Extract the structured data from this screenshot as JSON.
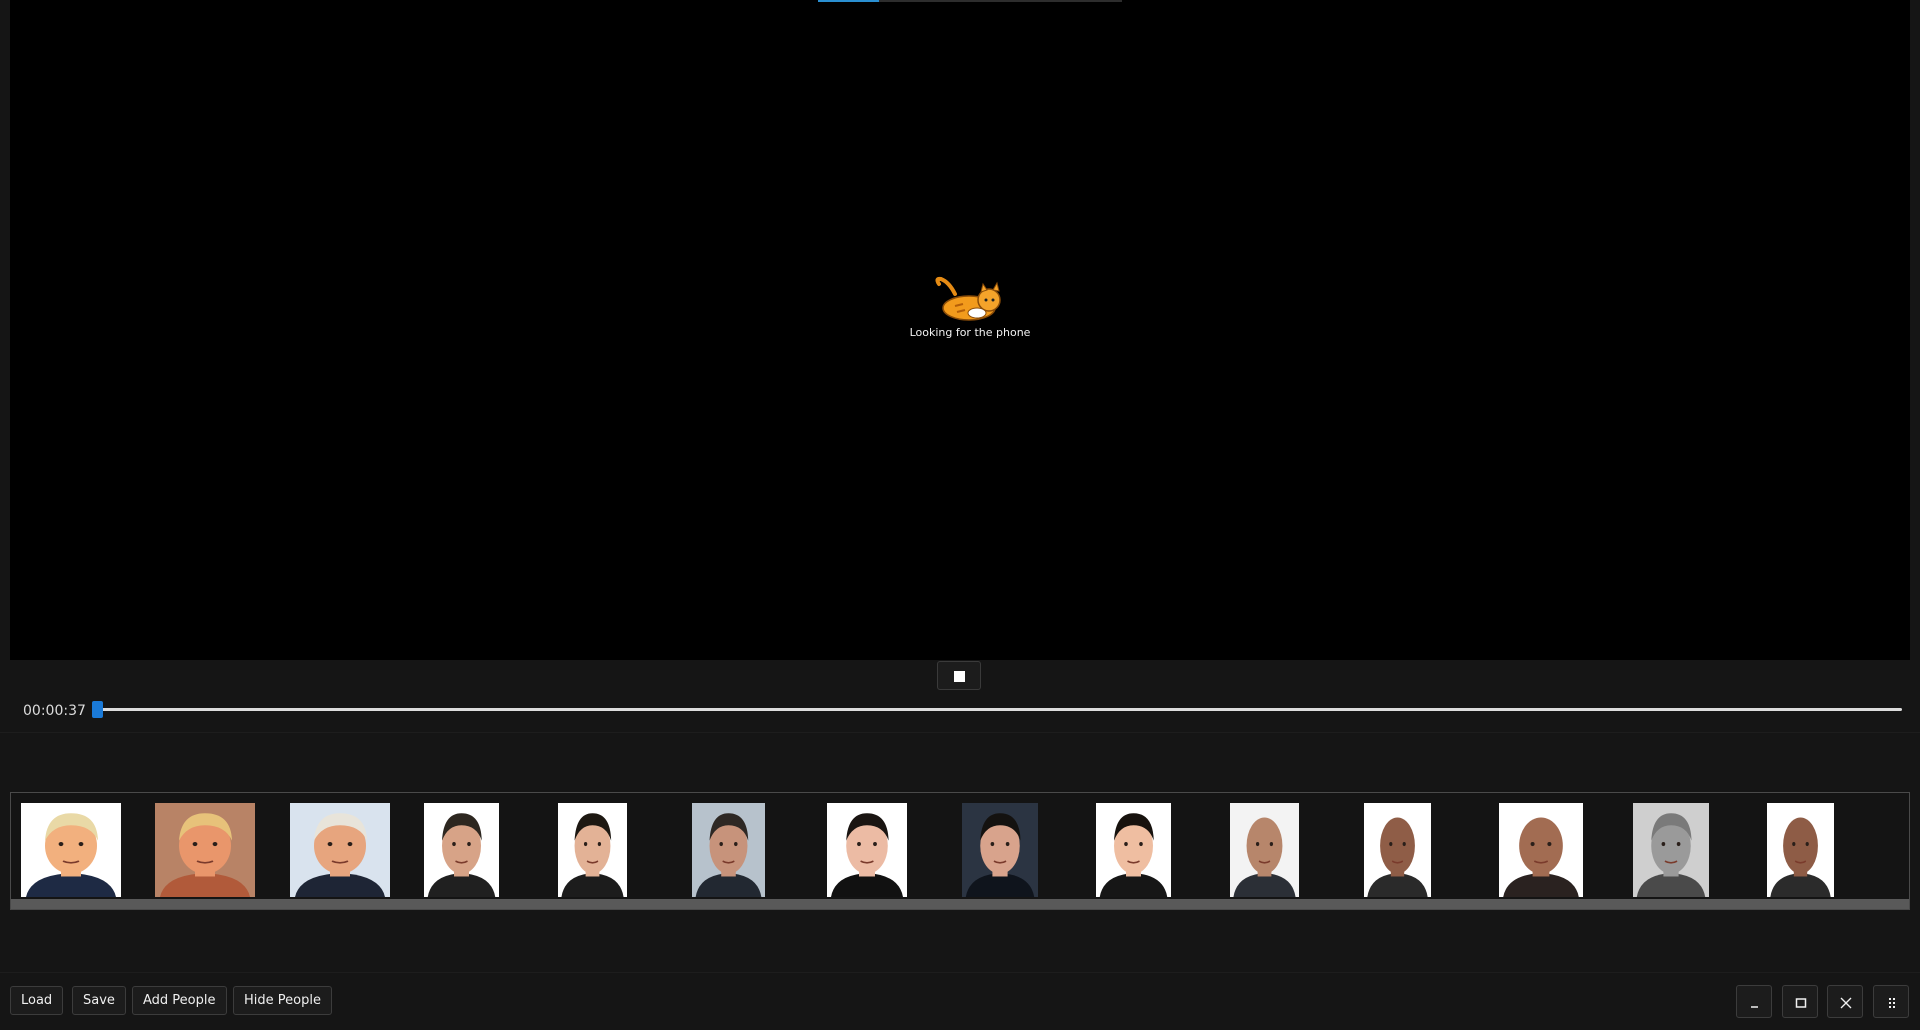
{
  "player": {
    "loading_text": "Looking for the phone",
    "top_progress": 0.2,
    "time": "00:00:37",
    "seek_position": 0.003
  },
  "people": [
    {
      "name": "",
      "bg": "#ffffff",
      "skin": "#f2b07e",
      "hair": "#e9d9a6",
      "suit": "#1e2a44"
    },
    {
      "name": "",
      "bg": "#b88366",
      "skin": "#e9966b",
      "hair": "#e7c27a",
      "suit": "#b15a3a"
    },
    {
      "name": "",
      "bg": "#d9e3ee",
      "skin": "#e7a57e",
      "hair": "#e8e4da",
      "suit": "#1e2535"
    },
    {
      "name": "",
      "bg": "#ffffff",
      "skin": "#d7a387",
      "hair": "#2d2720",
      "suit": "#202020"
    },
    {
      "name": "",
      "bg": "#ffffff",
      "skin": "#e3b296",
      "hair": "#1d1812",
      "suit": "#1c1c1c"
    },
    {
      "name": "",
      "bg": "#b7c2cc",
      "skin": "#c7937b",
      "hair": "#2e2824",
      "suit": "#222831"
    },
    {
      "name": "",
      "bg": "#ffffff",
      "skin": "#ecbba4",
      "hair": "#1a1512",
      "suit": "#111111"
    },
    {
      "name": "",
      "bg": "#2b3442",
      "skin": "#d8a38c",
      "hair": "#141210",
      "suit": "#0f141c"
    },
    {
      "name": "",
      "bg": "#ffffff",
      "skin": "#efbea1",
      "hair": "#17120e",
      "suit": "#161616"
    },
    {
      "name": "",
      "bg": "#f3f3f3",
      "skin": "#b7866b",
      "hair": "#b7866b",
      "suit": "#2b2f36"
    },
    {
      "name": "",
      "bg": "#ffffff",
      "skin": "#8f5d47",
      "hair": "#8f5d47",
      "suit": "#2a2a2a"
    },
    {
      "name": "",
      "bg": "#ffffff",
      "skin": "#a26c52",
      "hair": "#a26c52",
      "suit": "#2a2220"
    },
    {
      "name": "",
      "bg": "#cfcfcf",
      "skin": "#9a9a9a",
      "hair": "#7a7a7a",
      "suit": "#4a4a4a"
    },
    {
      "name": "",
      "bg": "#ffffff",
      "skin": "#8e5c46",
      "hair": "#8e5c46",
      "suit": "#2b2b2b"
    }
  ],
  "buttons": {
    "load": "Load",
    "save": "Save",
    "add_people": "Add People",
    "hide_people": "Hide People"
  },
  "window_controls": [
    "minimize-icon",
    "maximize-icon",
    "close-icon",
    "grip-icon"
  ],
  "colors": {
    "accent": "#1a7ad8",
    "background": "#151515",
    "video_bg": "#000000"
  }
}
